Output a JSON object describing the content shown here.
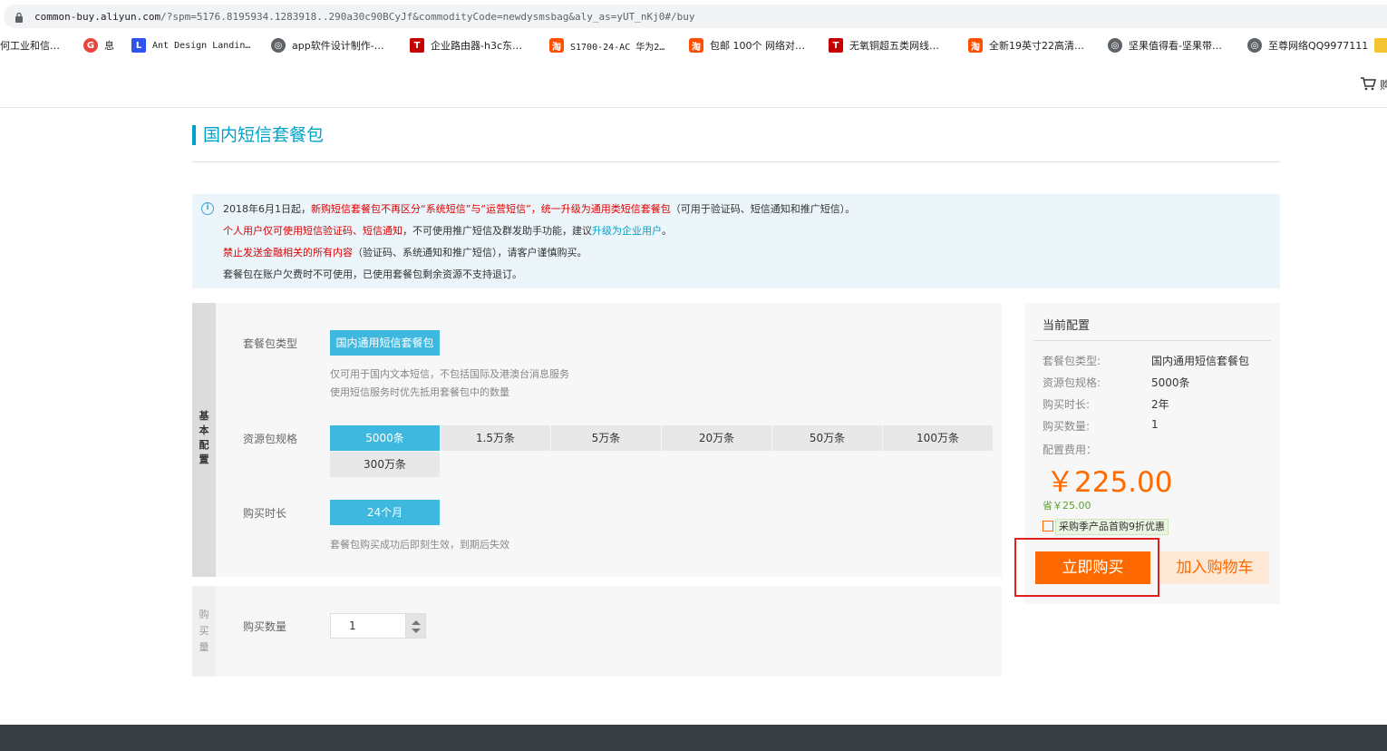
{
  "browser": {
    "url_host": "common-buy.aliyun.com",
    "url_rest": "/?spm=5176.8195934.1283918..290a30c90BCyJf&commodityCode=newdysmsbag&aly_as=yUT_nKj0#/buy",
    "bookmarks": [
      {
        "label": "何工业和信…",
        "icon": "none",
        "color": ""
      },
      {
        "label": "息",
        "icon": "circle-g-icon",
        "color": "#e8453c"
      },
      {
        "label": "Ant Design Landin…",
        "icon": "letter-l-icon",
        "color": "#2f54eb",
        "glyph": "L"
      },
      {
        "label": "app软件设计制作-…",
        "icon": "globe-icon",
        "color": "#5f6368"
      },
      {
        "label": "企业路由器-h3c东…",
        "icon": "tmall-icon",
        "color": "#c40000",
        "glyph": "T"
      },
      {
        "label": "S1700-24-AC 华为2…",
        "icon": "taobao-icon",
        "color": "#ff5000",
        "glyph": "淘"
      },
      {
        "label": "包邮 100个 网络对…",
        "icon": "taobao-icon",
        "color": "#ff5000",
        "glyph": "淘"
      },
      {
        "label": "无氧铜超五类网线…",
        "icon": "tmall-icon",
        "color": "#c40000",
        "glyph": "T"
      },
      {
        "label": "全新19英寸22高清…",
        "icon": "taobao-icon",
        "color": "#ff5000",
        "glyph": "淘"
      },
      {
        "label": "坚果值得看-坚果带…",
        "icon": "globe-icon",
        "color": "#5f6368"
      },
      {
        "label": "至尊网络QQ9977111",
        "icon": "globe-icon",
        "color": "#5f6368"
      }
    ]
  },
  "header": {
    "cart_label": "购"
  },
  "page": {
    "title": "国内短信套餐包"
  },
  "notice": {
    "line1_a": "2018年6月1日起，",
    "line1_b": "新购短信套餐包不再区分“系统短信”与“运营短信”，统一升级为通用类短信套餐包",
    "line1_c": "（可用于验证码、短信通知和推广短信）。",
    "line2_a": "个人用户仅可使用短信验证码、短信通知",
    "line2_b": "，不可使用推广短信及群发助手功能，建议",
    "line2_c": "升级为企业用户",
    "line2_d": "。",
    "line3_a": "禁止发送金融相关的所有内容",
    "line3_b": "（验证码、系统通知和推广短信），请客户谨慎购买。",
    "line4": "套餐包在账户欠费时不可使用，已使用套餐包剩余资源不支持退订。"
  },
  "config": {
    "tab_label": [
      "基",
      "本",
      "配",
      "置"
    ],
    "type_label": "套餐包类型",
    "type_option": "国内通用短信套餐包",
    "type_hint1": "仅可用于国内文本短信，不包括国际及港澳台消息服务",
    "type_hint2": "使用短信服务时优先抵用套餐包中的数量",
    "spec_label": "资源包规格",
    "spec_options": [
      "5000条",
      "1.5万条",
      "5万条",
      "20万条",
      "50万条",
      "100万条",
      "300万条"
    ],
    "spec_selected": "5000条",
    "duration_label": "购买时长",
    "duration_option": "24个月",
    "duration_hint": "套餐包购买成功后即刻生效，到期后失效"
  },
  "quantity": {
    "tab_label": [
      "购",
      "买",
      "量"
    ],
    "label": "购买数量",
    "value": "1"
  },
  "summary": {
    "title": "当前配置",
    "rows": [
      {
        "k": "套餐包类型:",
        "v": "国内通用短信套餐包"
      },
      {
        "k": "资源包规格:",
        "v": "5000条"
      },
      {
        "k": "购买时长:",
        "v": "2年"
      },
      {
        "k": "购买数量:",
        "v": "1"
      }
    ],
    "fee_label": "配置费用：",
    "price": "￥225.00",
    "save": "省￥25.00",
    "promo": "采购季产品首购9折优惠",
    "buy_label": "立即购买",
    "cart_label": "加入购物车"
  },
  "colors": {
    "accent": "#00a2ca",
    "orange": "#ff6a00",
    "selected": "#3fb8e0",
    "warning": "#e00000"
  }
}
